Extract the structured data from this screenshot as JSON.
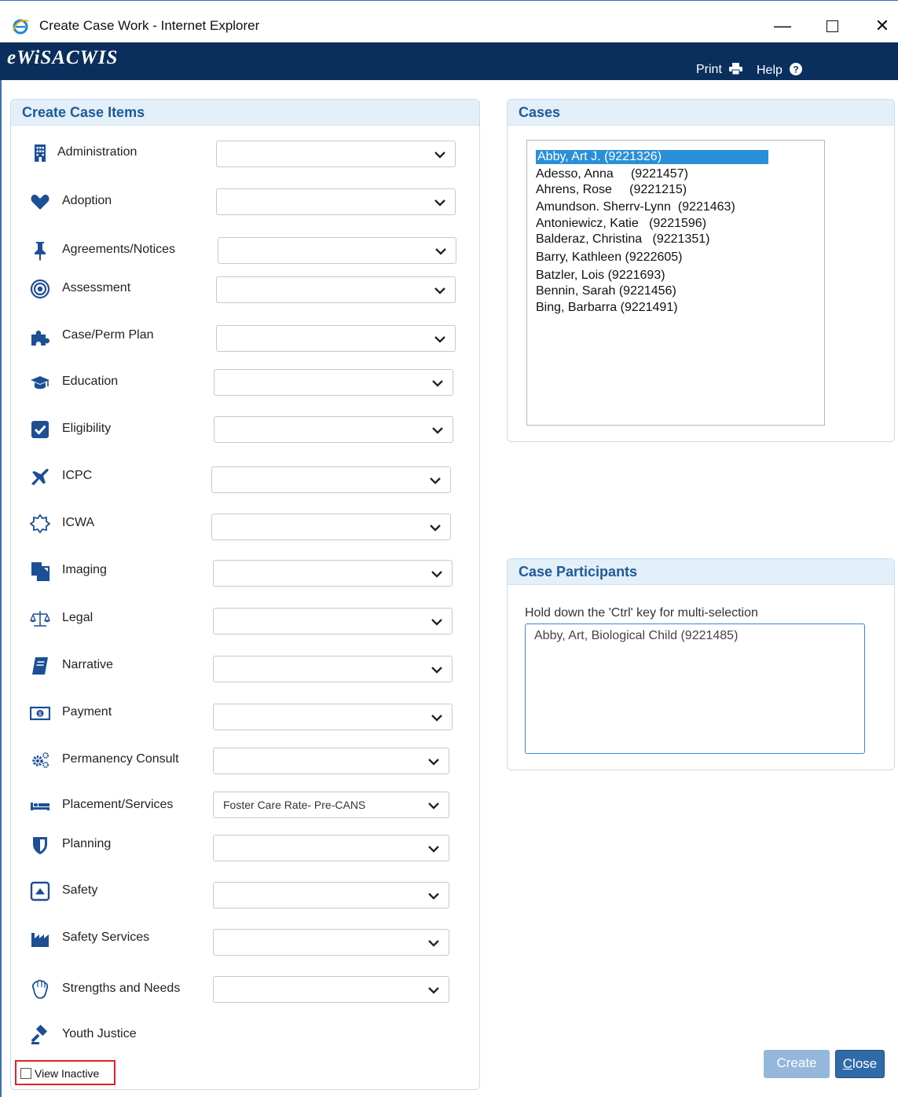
{
  "window": {
    "title": "Create Case Work - Internet Explorer",
    "minimize_glyph": "—",
    "close_glyph": "✕"
  },
  "appbar": {
    "brand": "eWiSACWIS",
    "print_label": "Print",
    "help_label": "Help"
  },
  "create_case_items": {
    "title": "Create Case Items",
    "items": [
      {
        "label": "Administration",
        "icon": "building-icon",
        "value": ""
      },
      {
        "label": "Adoption",
        "icon": "heart-icon",
        "value": ""
      },
      {
        "label": "Agreements/Notices",
        "icon": "pushpin-icon",
        "value": ""
      },
      {
        "label": "Assessment",
        "icon": "target-icon",
        "value": ""
      },
      {
        "label": "Case/Perm Plan",
        "icon": "puzzle-icon",
        "value": ""
      },
      {
        "label": "Education",
        "icon": "graduation-cap-icon",
        "value": ""
      },
      {
        "label": "Eligibility",
        "icon": "checkbox-checked-icon",
        "value": ""
      },
      {
        "label": "ICPC",
        "icon": "plane-icon",
        "value": ""
      },
      {
        "label": "ICWA",
        "icon": "sun-outline-icon",
        "value": ""
      },
      {
        "label": "Imaging",
        "icon": "copy-icon",
        "value": ""
      },
      {
        "label": "Legal",
        "icon": "scales-icon",
        "value": ""
      },
      {
        "label": "Narrative",
        "icon": "book-icon",
        "value": ""
      },
      {
        "label": "Payment",
        "icon": "money-icon",
        "value": ""
      },
      {
        "label": "Permanency Consult",
        "icon": "cogs-icon",
        "value": ""
      },
      {
        "label": "Placement/Services",
        "icon": "bed-icon",
        "value": "Foster Care Rate- Pre-CANS"
      },
      {
        "label": "Planning",
        "icon": "shield-icon",
        "value": ""
      },
      {
        "label": "Safety",
        "icon": "caret-square-up-icon",
        "value": ""
      },
      {
        "label": "Safety Services",
        "icon": "industry-icon",
        "value": ""
      },
      {
        "label": "Strengths and Needs",
        "icon": "hand-icon",
        "value": ""
      },
      {
        "label": "Youth Justice",
        "icon": "gavel-icon",
        "value": ""
      }
    ],
    "view_inactive_label": "View Inactive"
  },
  "cases": {
    "title": "Cases",
    "rows": [
      "Abby, Art J. (9221326)",
      "Adesso, Anna     (9221457)",
      "Ahrens, Rose     (9221215)",
      "Amundson. Sherrv-Lynn  (9221463)",
      "Antoniewicz, Katie   (9221596)",
      "Balderaz, Christina   (9221351)",
      "Barry, Kathleen (9222605)",
      "Batzler, Lois (9221693)",
      "Bennin, Sarah (9221456)",
      "Bing, Barbarra (9221491)"
    ],
    "selected_index": 0
  },
  "case_participants": {
    "title": "Case Participants",
    "hint": "Hold down the 'Ctrl' key for multi-selection",
    "rows": [
      "Abby, Art, Biological Child (9221485)"
    ]
  },
  "buttons": {
    "create": "Create",
    "close": "Close"
  },
  "colors": {
    "appbar": "#0a2f5c",
    "panel_header_text": "#1d5b96",
    "selected_row": "#2a8fd8",
    "create_disabled": "#93b8db",
    "close_button": "#2f6ba8",
    "highlight_box": "#e0202a",
    "icon": "#1c4f94"
  }
}
